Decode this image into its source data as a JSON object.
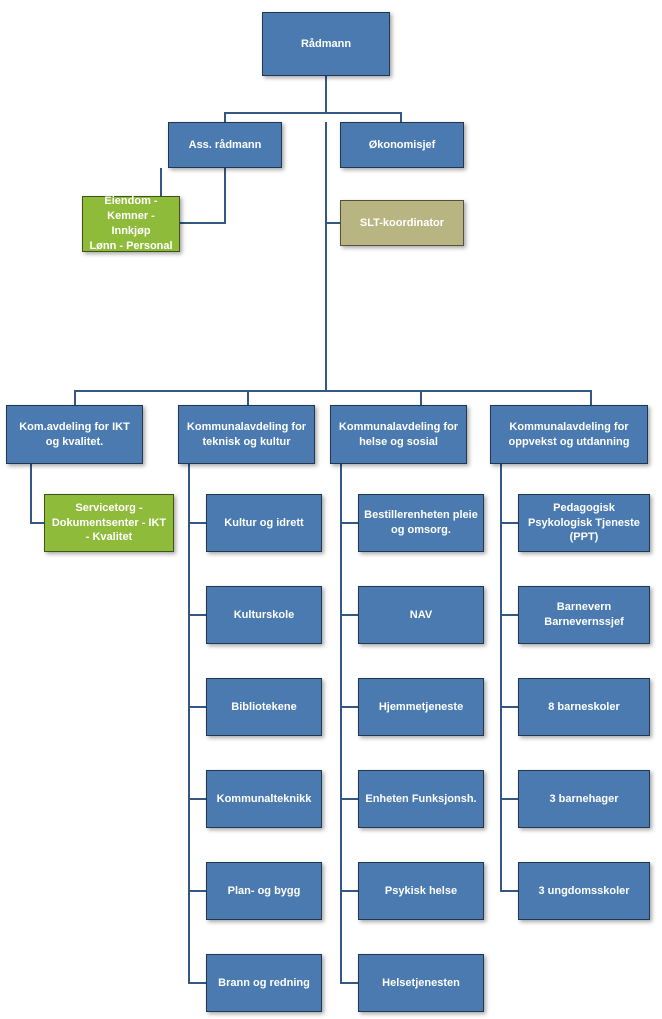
{
  "root": {
    "title": "Rådmann"
  },
  "level2": {
    "ass": "Ass. rådmann",
    "okon": "Økonomisjef"
  },
  "level3": {
    "eiendom": "Eiendom -\nKemner - Innkjøp\nLønn - Personal",
    "slt": "SLT-koordinator"
  },
  "depts": {
    "ikt": "Kom.avdeling for IKT og kvalitet.",
    "teknisk": "Kommunalavdeling for teknisk og kultur",
    "helse": "Kommunalavdeling for helse og sosial",
    "oppvekst": "Kommunalavdeling for oppvekst og utdanning"
  },
  "ikt_children": [
    "Servicetorg - Dokumentsenter - IKT - Kvalitet"
  ],
  "teknisk_children": [
    "Kultur og idrett",
    "Kulturskole",
    "Bibliotekene",
    "Kommunalteknikk",
    "Plan- og bygg",
    "Brann og redning"
  ],
  "helse_children": [
    "Bestillerenheten pleie og omsorg.",
    "NAV",
    "Hjemmetjeneste",
    "Enheten Funksjonsh.",
    "Psykisk helse",
    "Helsetjenesten"
  ],
  "oppvekst_children": [
    "Pedagogisk Psykologisk Tjeneste (PPT)",
    "Barnevern Barnevernssjef",
    "8 barneskoler",
    "3 barnehager",
    "3 ungdomsskoler"
  ]
}
